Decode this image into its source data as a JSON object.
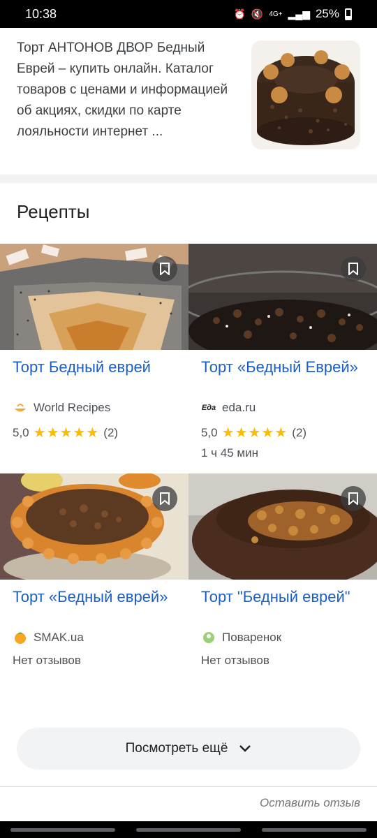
{
  "status": {
    "time": "10:38",
    "network": "4G+",
    "battery": "25%"
  },
  "snippet": {
    "text": "Торт АНТОНОВ ДВОР Бедный Еврей – купить онлайн. Каталог товаров с ценами и информацией об акциях, скидки по карте лояльности интернет ..."
  },
  "section": {
    "title": "Рецепты"
  },
  "recipes": [
    {
      "title": "Торт Бедный еврей",
      "source": "World Recipes",
      "rating": "5,0",
      "stars": "★★★★★",
      "reviews": "(2)",
      "time": ""
    },
    {
      "title": "Торт «Бедный Еврей»",
      "source": "eda.ru",
      "rating": "5,0",
      "stars": "★★★★★",
      "reviews": "(2)",
      "time": "1 ч 45 мин"
    },
    {
      "title": "Торт «Бедный еврей»",
      "source": "SMAK.ua",
      "no_reviews": "Нет отзывов"
    },
    {
      "title": "Торт \"Бедный еврей\"",
      "source": "Поваренок",
      "no_reviews": "Нет отзывов"
    }
  ],
  "more_button": {
    "label": "Посмотреть ещё"
  },
  "feedback": {
    "label": "Оставить отзыв"
  },
  "icons": {
    "bookmark": "bookmark-icon",
    "chevron": "chevron-down-icon"
  },
  "colors": {
    "link": "#1a5fc7",
    "star": "#fbbc04",
    "button_bg": "#f1f3f4"
  }
}
